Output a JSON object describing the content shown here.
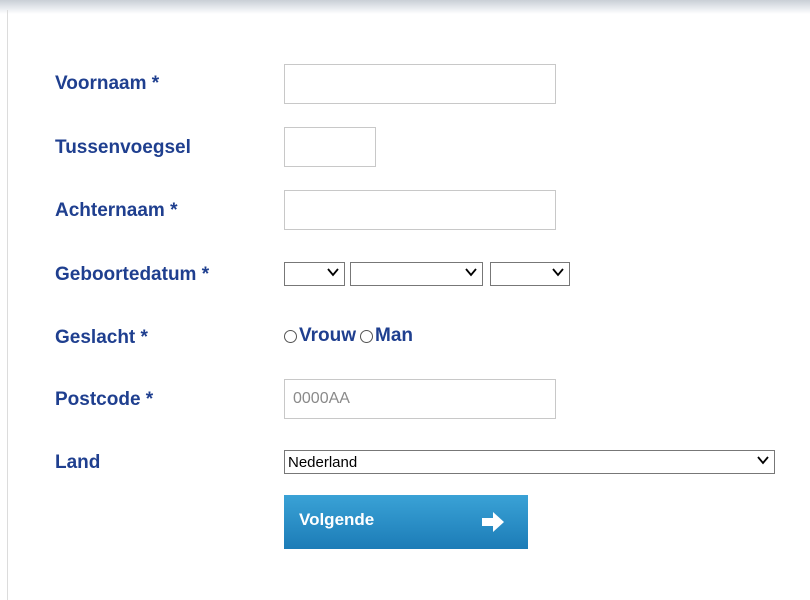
{
  "form": {
    "voornaam_label": "Voornaam *",
    "tussenvoegsel_label": "Tussenvoegsel",
    "achternaam_label": "Achternaam *",
    "geboortedatum_label": "Geboortedatum *",
    "geslacht_label": "Geslacht *",
    "postcode_label": "Postcode *",
    "land_label": "Land",
    "voornaam_value": "",
    "tussenvoegsel_value": "",
    "achternaam_value": "",
    "postcode_placeholder": "0000AA",
    "day_value": "",
    "month_value": "",
    "year_value": "",
    "gender_options": [
      "Vrouw",
      "Man"
    ],
    "land_value": "Nederland"
  },
  "actions": {
    "next_label": "Volgende"
  },
  "colors": {
    "label_color": "#1f3f8f",
    "button_top": "#3aa2d6",
    "button_bottom": "#1c7cb7"
  },
  "icons": {
    "dropdown": "chevron-down-icon",
    "next": "arrow-right-icon"
  }
}
